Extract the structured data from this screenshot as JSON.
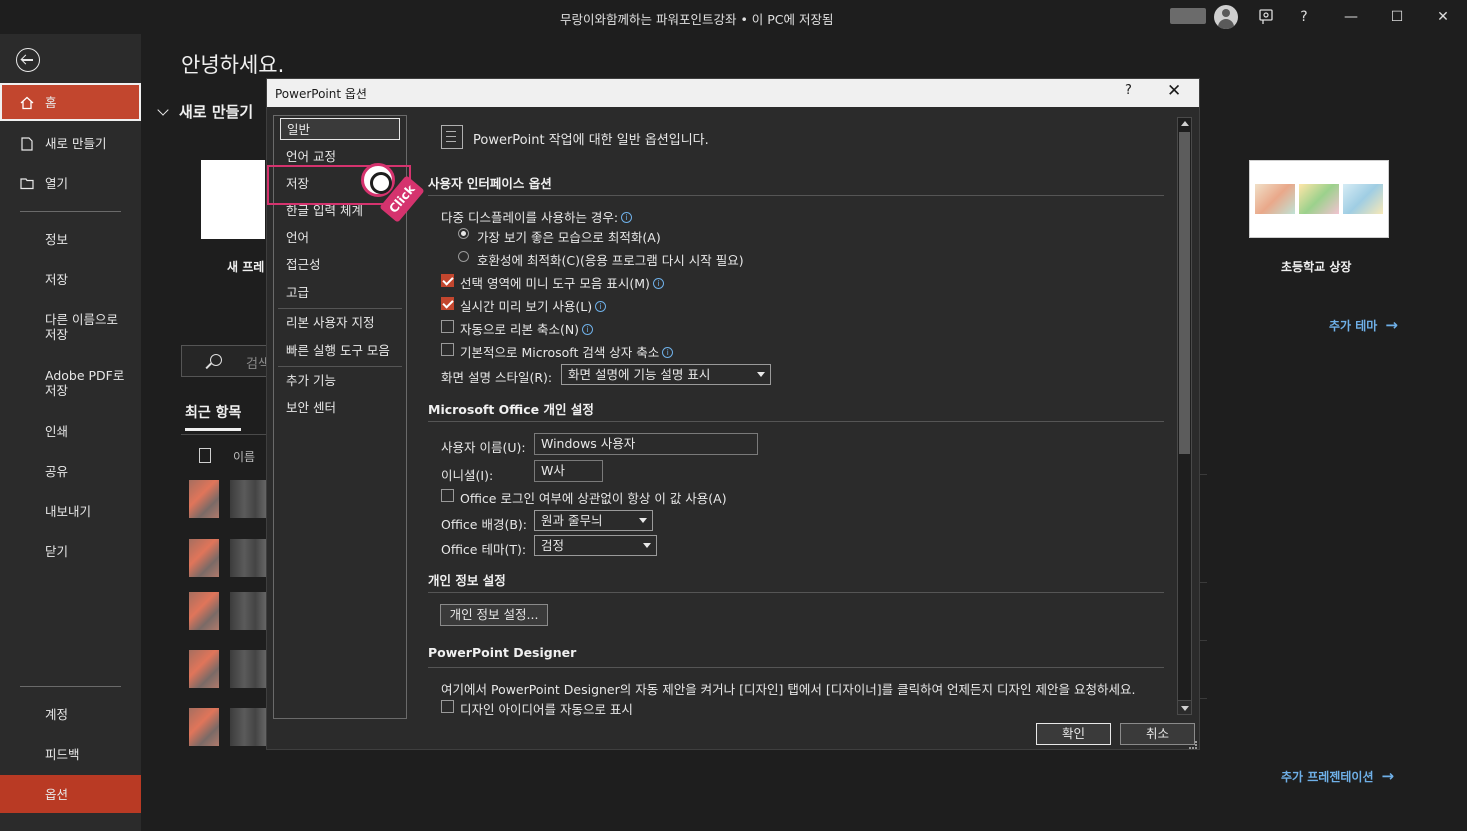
{
  "window": {
    "title": "무랑이와함께하는 파워포인트강좌 • 이 PC에 저장됨"
  },
  "titlebar_icons": {
    "avatar": "user-avatar-icon",
    "coauthor": "coauthor-icon",
    "help": "?",
    "minimize": "—",
    "maximize": "☐",
    "close": "✕"
  },
  "leftnav": {
    "items": [
      {
        "label": "홈",
        "icon": "home-icon"
      },
      {
        "label": "새로 만들기",
        "icon": "new-doc-icon"
      },
      {
        "label": "열기",
        "icon": "folder-open-icon"
      },
      {
        "label": "정보"
      },
      {
        "label": "저장"
      },
      {
        "label": "다른 이름으로\n저장"
      },
      {
        "label": "Adobe PDF로\n저장"
      },
      {
        "label": "인쇄"
      },
      {
        "label": "공유"
      },
      {
        "label": "내보내기"
      },
      {
        "label": "닫기"
      },
      {
        "label": "계정"
      },
      {
        "label": "피드백"
      },
      {
        "label": "옵션"
      }
    ]
  },
  "main": {
    "greeting": "안녕하세요.",
    "new_section": "새로 만들기",
    "blank_label": "새 프레",
    "theme_label": "초등학교 상장",
    "more_themes": "추가 테마",
    "search_placeholder": "검색",
    "recent_tab": "최근 항목",
    "col_name": "이름",
    "more_presentations": "추가 프레젠테이션"
  },
  "dialog": {
    "title": "PowerPoint 옵션",
    "help": "?",
    "close": "✕",
    "sidebar": [
      {
        "label": "일반",
        "selected": true
      },
      {
        "label": "언어 교정"
      },
      {
        "label": "저장"
      },
      {
        "label": "한글 입력 체계"
      },
      {
        "label": "언어"
      },
      {
        "label": "접근성"
      },
      {
        "label": "고급"
      },
      {
        "label": "리본 사용자 지정"
      },
      {
        "label": "빠른 실행 도구 모음"
      },
      {
        "label": "추가 기능"
      },
      {
        "label": "보안 센터"
      }
    ],
    "click_label": "Click",
    "intro": "PowerPoint 작업에 대한 일반 옵션입니다.",
    "ui_section": "사용자 인터페이스 옵션",
    "multi_display": "다중 디스플레이를 사용하는 경우:",
    "radio_best": "가장 보기 좋은 모습으로 최적화(A)",
    "radio_compat": "호환성에 최적화(C)(응용 프로그램 다시 시작 필요)",
    "chk_mini_toolbar": "선택 영역에 미니 도구 모음 표시(M)",
    "chk_live_preview": "실시간 미리 보기 사용(L)",
    "chk_collapse_ribbon": "자동으로 리본 축소(N)",
    "chk_collapse_search": "기본적으로 Microsoft 검색 상자 축소",
    "screentip_label": "화면 설명 스타일(R):",
    "screentip_value": "화면 설명에 기능 설명 표시",
    "office_section": "Microsoft Office 개인 설정",
    "username_label": "사용자 이름(U):",
    "username_value": "Windows 사용자",
    "initials_label": "이니셜(I):",
    "initials_value": "W사",
    "chk_always_use": "Office 로그인 여부에 상관없이 항상 이 값 사용(A)",
    "background_label": "Office 배경(B):",
    "background_value": "원과 줄무늬",
    "theme_label": "Office 테마(T):",
    "theme_value": "검정",
    "privacy_section": "개인 정보 설정",
    "privacy_button": "개인 정보 설정...",
    "designer_section": "PowerPoint Designer",
    "designer_desc": "여기에서 PowerPoint Designer의 자동 제안을 켜거나 [디자인] 탭에서 [디자이너]를 클릭하여 언제든지 디자인 제안을 요청하세요.",
    "chk_designer": "디자인 아이디어를 자동으로 표시",
    "ok": "확인",
    "cancel": "취소"
  }
}
